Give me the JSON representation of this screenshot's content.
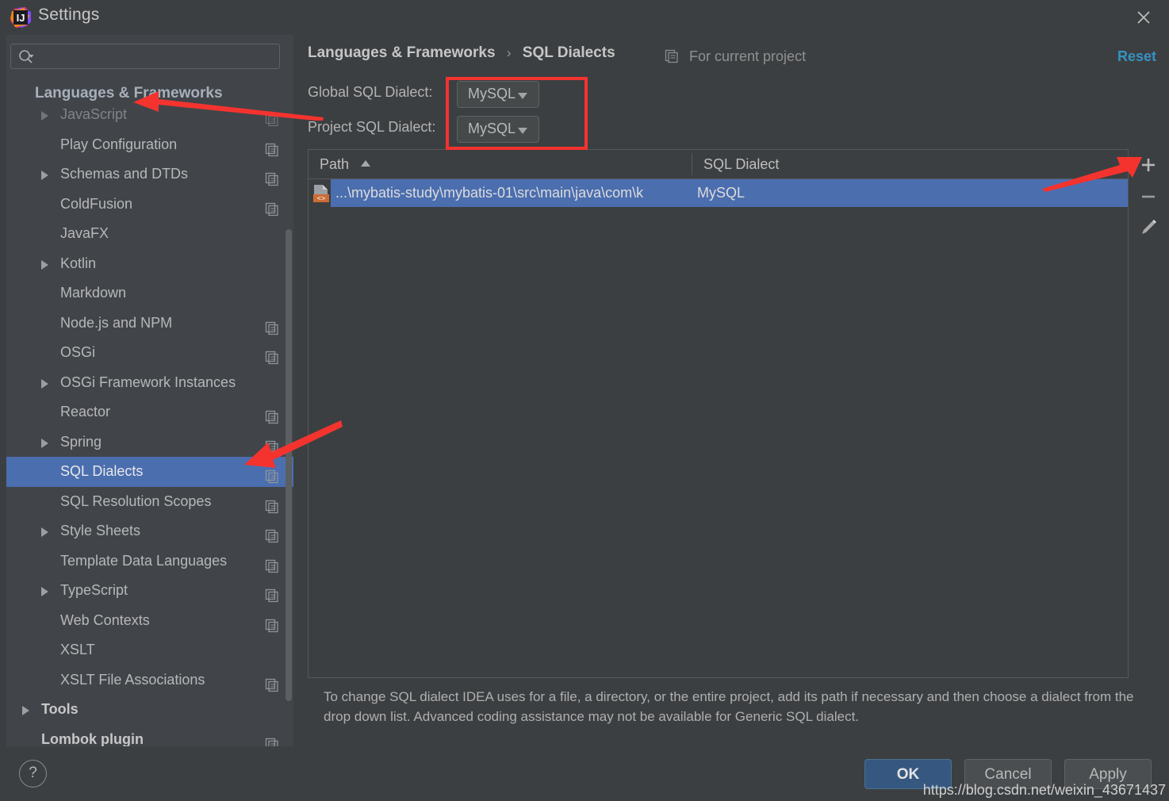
{
  "window": {
    "title": "Settings",
    "logo_icon": "intellij-idea-logo",
    "close_icon": "close-icon"
  },
  "search": {
    "value": "",
    "placeholder": "",
    "icon": "search-icon"
  },
  "sidebar": {
    "header": "Languages & Frameworks",
    "items": [
      {
        "label": "JavaScript",
        "arrow": true,
        "copy": true,
        "root": false,
        "bold": false,
        "selected": false,
        "faded": true
      },
      {
        "label": "Play Configuration",
        "arrow": false,
        "copy": true,
        "root": false,
        "bold": false,
        "selected": false,
        "faded": false
      },
      {
        "label": "Schemas and DTDs",
        "arrow": true,
        "copy": true,
        "root": false,
        "bold": false,
        "selected": false,
        "faded": false
      },
      {
        "label": "ColdFusion",
        "arrow": false,
        "copy": true,
        "root": false,
        "bold": false,
        "selected": false,
        "faded": false
      },
      {
        "label": "JavaFX",
        "arrow": false,
        "copy": false,
        "root": false,
        "bold": false,
        "selected": false,
        "faded": false
      },
      {
        "label": "Kotlin",
        "arrow": true,
        "copy": false,
        "root": false,
        "bold": false,
        "selected": false,
        "faded": false
      },
      {
        "label": "Markdown",
        "arrow": false,
        "copy": false,
        "root": false,
        "bold": false,
        "selected": false,
        "faded": false
      },
      {
        "label": "Node.js and NPM",
        "arrow": false,
        "copy": true,
        "root": false,
        "bold": false,
        "selected": false,
        "faded": false
      },
      {
        "label": "OSGi",
        "arrow": false,
        "copy": true,
        "root": false,
        "bold": false,
        "selected": false,
        "faded": false
      },
      {
        "label": "OSGi Framework Instances",
        "arrow": true,
        "copy": false,
        "root": false,
        "bold": false,
        "selected": false,
        "faded": false
      },
      {
        "label": "Reactor",
        "arrow": false,
        "copy": true,
        "root": false,
        "bold": false,
        "selected": false,
        "faded": false
      },
      {
        "label": "Spring",
        "arrow": true,
        "copy": true,
        "root": false,
        "bold": false,
        "selected": false,
        "faded": false
      },
      {
        "label": "SQL Dialects",
        "arrow": false,
        "copy": true,
        "root": false,
        "bold": false,
        "selected": true,
        "faded": false
      },
      {
        "label": "SQL Resolution Scopes",
        "arrow": false,
        "copy": true,
        "root": false,
        "bold": false,
        "selected": false,
        "faded": false
      },
      {
        "label": "Style Sheets",
        "arrow": true,
        "copy": true,
        "root": false,
        "bold": false,
        "selected": false,
        "faded": false
      },
      {
        "label": "Template Data Languages",
        "arrow": false,
        "copy": true,
        "root": false,
        "bold": false,
        "selected": false,
        "faded": false
      },
      {
        "label": "TypeScript",
        "arrow": true,
        "copy": true,
        "root": false,
        "bold": false,
        "selected": false,
        "faded": false
      },
      {
        "label": "Web Contexts",
        "arrow": false,
        "copy": true,
        "root": false,
        "bold": false,
        "selected": false,
        "faded": false
      },
      {
        "label": "XSLT",
        "arrow": false,
        "copy": false,
        "root": false,
        "bold": false,
        "selected": false,
        "faded": false
      },
      {
        "label": "XSLT File Associations",
        "arrow": false,
        "copy": true,
        "root": false,
        "bold": false,
        "selected": false,
        "faded": false
      },
      {
        "label": "Tools",
        "arrow": true,
        "copy": false,
        "root": true,
        "bold": true,
        "selected": false,
        "faded": false
      },
      {
        "label": "Lombok plugin",
        "arrow": false,
        "copy": true,
        "root": true,
        "bold": true,
        "selected": false,
        "faded": false
      }
    ]
  },
  "main": {
    "breadcrumb": {
      "parent": "Languages & Frameworks",
      "separator": "›",
      "current": "SQL Dialects"
    },
    "scope_note": {
      "label": "For current project",
      "icon": "pages-icon"
    },
    "reset_label": "Reset",
    "fields": [
      {
        "label": "Global SQL Dialect:",
        "value": "MySQL"
      },
      {
        "label": "Project SQL Dialect:",
        "value": "MySQL"
      }
    ],
    "table": {
      "columns": [
        "Path",
        "SQL Dialect"
      ],
      "sort_column": "Path",
      "sort_direction": "ascending",
      "rows": [
        {
          "path": "...\\mybatis-study\\mybatis-01\\src\\main\\java\\com\\k",
          "dialect": "MySQL",
          "icon": "xml-file-icon",
          "selected": true
        }
      ]
    },
    "table_tools": [
      {
        "name": "add-path-button",
        "icon": "plus-icon"
      },
      {
        "name": "remove-path-button",
        "icon": "minus-icon"
      },
      {
        "name": "edit-path-button",
        "icon": "pencil-icon"
      }
    ],
    "hint": "To change SQL dialect IDEA uses for a file, a directory, or the entire project, add its path if necessary and then choose a dialect from the drop down list. Advanced coding assistance may not be available for Generic SQL dialect."
  },
  "footer": {
    "help_label": "?",
    "ok_label": "OK",
    "cancel_label": "Cancel",
    "apply_label": "Apply"
  },
  "overlay": {
    "watermark": "https://blog.csdn.net/weixin_43671437",
    "annotation_color": "#F4332F"
  }
}
